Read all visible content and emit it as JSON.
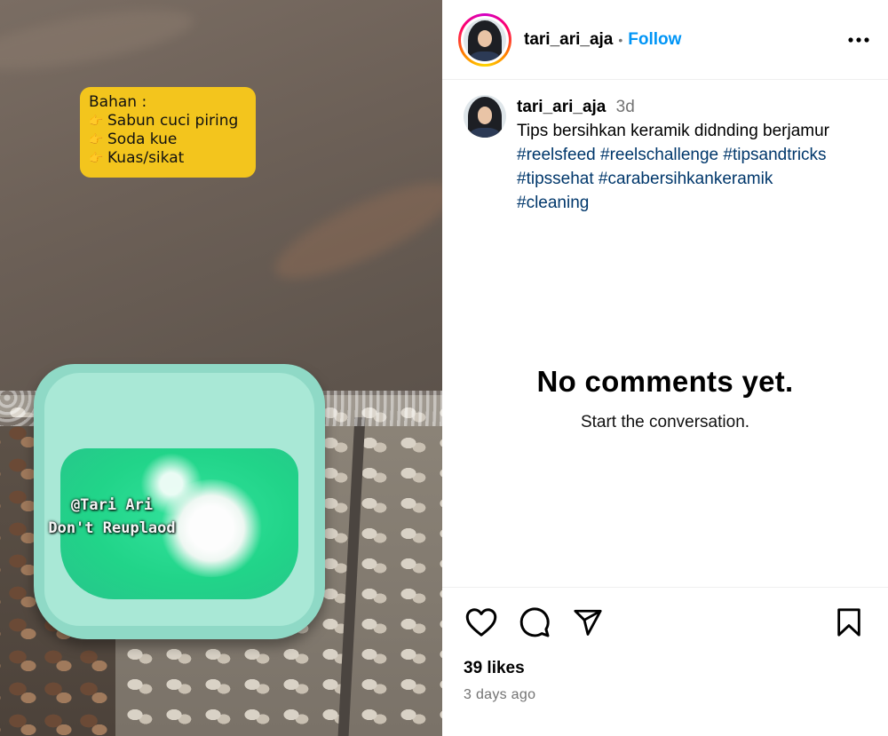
{
  "media": {
    "overlay_title": "Bahan :",
    "overlay_items": [
      "Sabun cuci piring",
      "Soda kue",
      "Kuas/sikat"
    ],
    "watermark_line1": "@Tari Ari",
    "watermark_line2": "Don't Reuplaod"
  },
  "header": {
    "username": "tari_ari_aja",
    "separator": "•",
    "follow_label": "Follow"
  },
  "caption": {
    "username": "tari_ari_aja",
    "time": "3d",
    "text": "Tips bersihkan keramik didnding berjamur",
    "hashtags": [
      "#reelsfeed",
      "#reelschallenge",
      "#tipsandtricks",
      "#tipssehat",
      "#carabersihkankeramik",
      "#cleaning"
    ]
  },
  "empty_state": {
    "title": "No comments yet.",
    "subtitle": "Start the conversation."
  },
  "footer": {
    "likes": "39 likes",
    "timestamp": "3 days ago"
  },
  "icons": {
    "like": "heart-icon",
    "comment": "comment-icon",
    "share": "share-icon",
    "save": "bookmark-icon",
    "more": "more-options-icon"
  },
  "colors": {
    "follow": "#0095f6",
    "hashtag": "#00376b",
    "overlay_bg": "#f3c51d"
  }
}
